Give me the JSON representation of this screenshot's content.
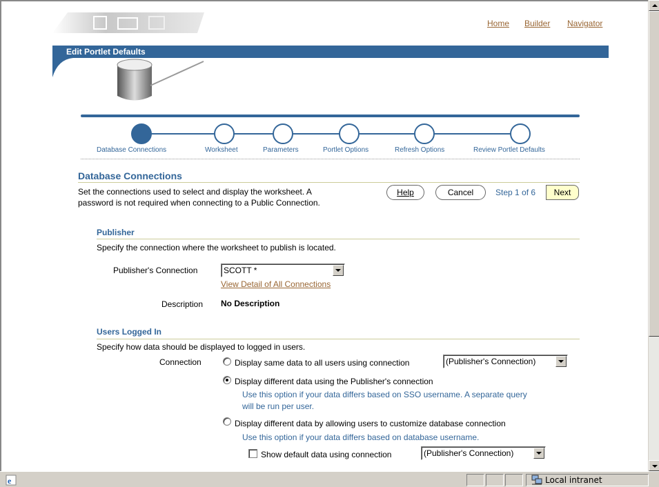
{
  "header": {
    "links": [
      "Home",
      "Builder",
      "Navigator"
    ],
    "page_title": "Edit Portlet Defaults"
  },
  "train": {
    "steps": [
      "Database Connections",
      "Worksheet",
      "Parameters",
      "Portlet Options",
      "Refresh Options",
      "Review Portlet Defaults"
    ],
    "active_index": 0
  },
  "section": {
    "title": "Database Connections",
    "instructions_line1": "Set the connections used to select and display the worksheet. A",
    "instructions_line2": "password is not required when connecting to a Public Connection.",
    "help_label": "Help",
    "cancel_label": "Cancel",
    "step_text": "Step 1 of 6",
    "next_label": "Next"
  },
  "publisher": {
    "heading": "Publisher",
    "instructions": "Specify the connection where the worksheet to publish is located.",
    "connection_label": "Publisher's Connection",
    "connection_value": "SCOTT *",
    "view_detail_link": "View Detail of All Connections",
    "description_label": "Description",
    "description_value": "No Description"
  },
  "users": {
    "heading": "Users Logged In",
    "instructions": "Specify how data should be displayed to logged in users.",
    "connection_label": "Connection",
    "option1": "Display same data to all users using connection",
    "option1_select": "(Publisher's Connection)",
    "option2": "Display different data using the Publisher's connection",
    "option2_tip_line1": "Use this option if your data differs based on SSO username. A separate query",
    "option2_tip_line2": "will be run per user.",
    "option3": "Display different data by allowing users to customize database connection",
    "option3_tip": "Use this option if your data differs based on database username.",
    "checkbox_label": "Show default data using connection",
    "checkbox_select": "(Publisher's Connection)",
    "selected_option": 2
  },
  "statusbar": {
    "zone": "Local intranet"
  },
  "colors": {
    "brand_blue": "#336699",
    "link_brown": "#996633",
    "rule_khaki": "#cccc99"
  }
}
